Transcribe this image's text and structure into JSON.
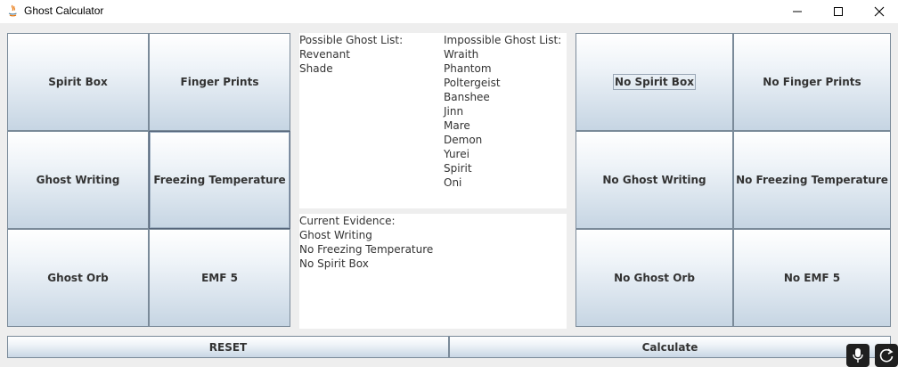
{
  "window": {
    "title": "Ghost Calculator",
    "app_icon": "java-icon"
  },
  "evidence_buttons": [
    {
      "label": "Spirit Box"
    },
    {
      "label": "Finger Prints"
    },
    {
      "label": "Ghost Writing"
    },
    {
      "label": "Freezing Temperature"
    },
    {
      "label": "Ghost Orb"
    },
    {
      "label": "EMF 5"
    }
  ],
  "negative_buttons": [
    {
      "label": "No Spirit Box"
    },
    {
      "label": "No Finger Prints"
    },
    {
      "label": "No Ghost Writing"
    },
    {
      "label": "No Freezing Temperature"
    },
    {
      "label": "No Ghost Orb"
    },
    {
      "label": "No EMF 5"
    }
  ],
  "possible": {
    "header": "Possible Ghost List:",
    "items": [
      "Revenant",
      "Shade"
    ]
  },
  "impossible": {
    "header": "Impossible Ghost List:",
    "items": [
      "Wraith",
      "Phantom",
      "Poltergeist",
      "Banshee",
      "Jinn",
      "Mare",
      "Demon",
      "Yurei",
      "Spirit",
      "Oni"
    ]
  },
  "current_evidence": {
    "header": "Current Evidence:",
    "items": [
      "Ghost Writing",
      "No Freezing Temperature",
      "No Spirit Box"
    ]
  },
  "actions": {
    "reset_label": "RESET",
    "calculate_label": "Calculate"
  },
  "tray": {
    "mic_icon": "microphone-icon",
    "refresh_icon": "refresh-icon"
  }
}
